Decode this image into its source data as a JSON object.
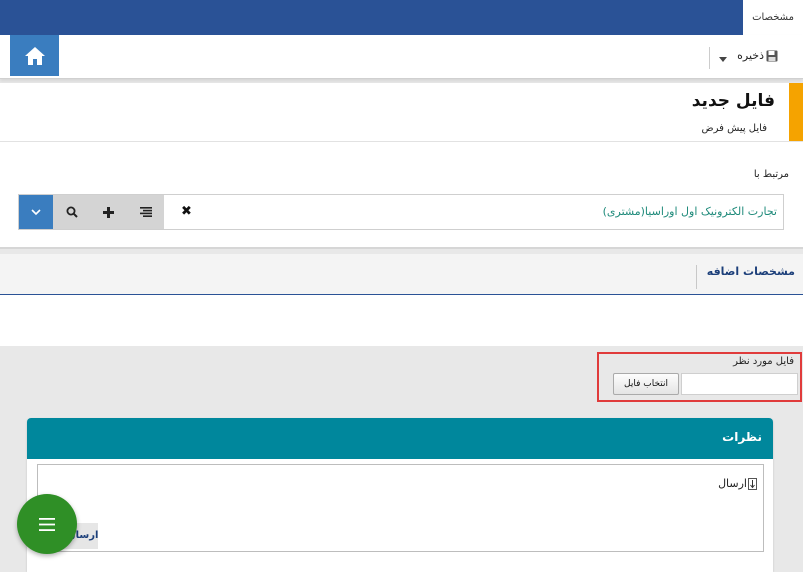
{
  "topbar": {
    "tab_label": "مشخصات",
    "color": "#2a5296"
  },
  "toolbar": {
    "save_label": "ذخیره",
    "home_icon": "home-icon",
    "save_icon": "floppy-disk-icon"
  },
  "title_card": {
    "title": "فایل جدید",
    "subtitle": "فایل پیش فرض",
    "accent_color": "#f5a300"
  },
  "related": {
    "label": "مرتبط با",
    "value": "تجارت الکترونیک اول اوراسیا(مشتری)",
    "buttons": [
      "list-icon",
      "add-icon",
      "search-icon",
      "chevron-down-icon"
    ],
    "clear_symbol": "✖"
  },
  "tabs": [
    {
      "label": "مشخصات اضافه",
      "active": true
    }
  ],
  "file_field": {
    "label": "فایل مورد نظر",
    "button_label": "انتخاب فایل",
    "value": ""
  },
  "comments": {
    "title": "نظرات",
    "text": "ارسال",
    "send_label": "ارسال",
    "header_color": "#00879c"
  },
  "fab": {
    "icon": "menu-icon",
    "color": "#2f8f26"
  }
}
